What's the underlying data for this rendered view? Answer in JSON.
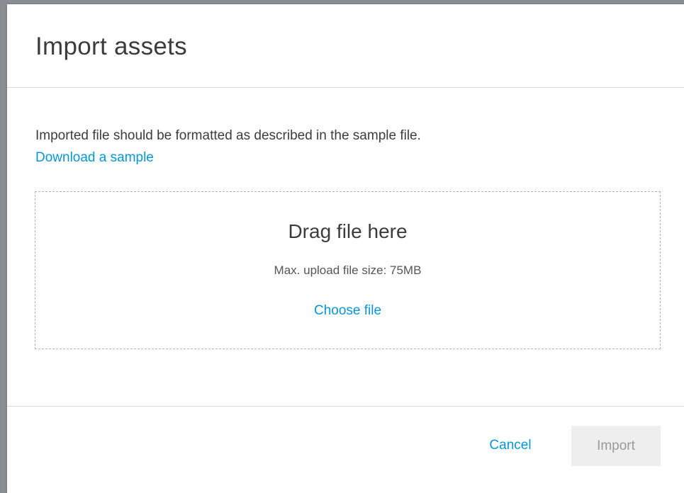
{
  "dialog": {
    "title": "Import assets"
  },
  "body": {
    "description": "Imported file should be formatted as described in the sample file.",
    "sample_link": "Download a sample"
  },
  "dropzone": {
    "title": "Drag file here",
    "hint": "Max. upload file size: 75MB",
    "choose_link": "Choose file"
  },
  "footer": {
    "cancel_label": "Cancel",
    "import_label": "Import",
    "import_disabled": true
  },
  "colors": {
    "link": "#0696d7",
    "text": "#3c3c3c",
    "disabled_bg": "#eeeeee",
    "disabled_text": "#9a9a9a"
  }
}
